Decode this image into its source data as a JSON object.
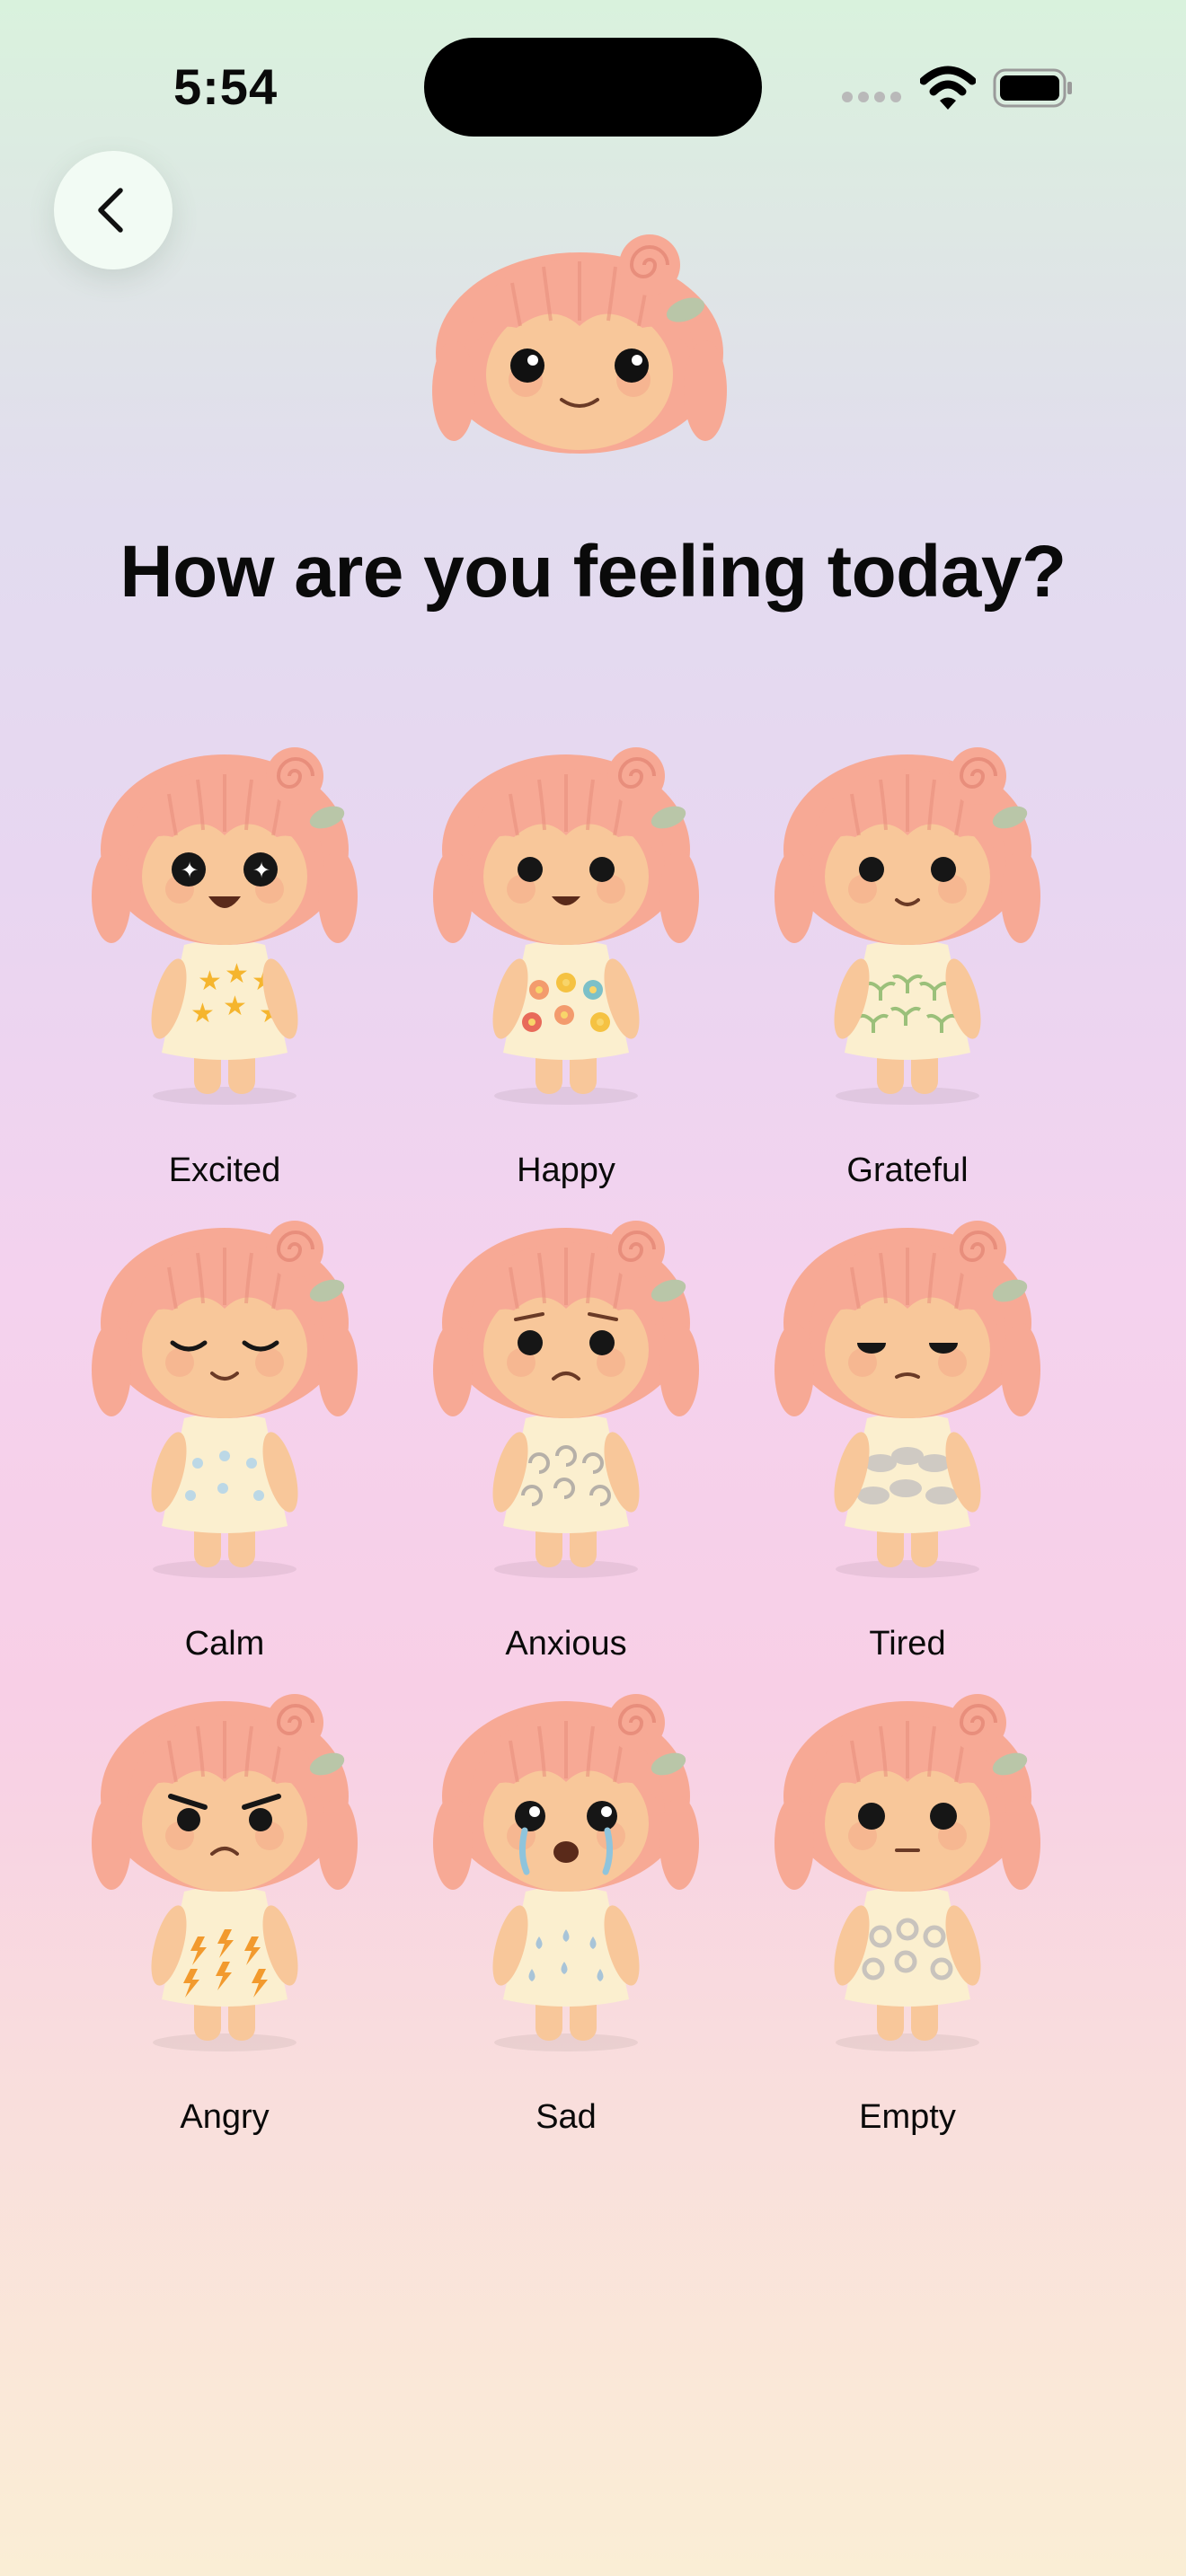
{
  "status_bar": {
    "time": "5:54"
  },
  "colors": {
    "hair": "#f7a995",
    "hair_shade": "#e88e7c",
    "skin": "#f8c79a",
    "skin_shade": "#eeb183",
    "dress": "#fbefcf",
    "clip": "#b9c6a8",
    "back_button_bg": "#f2fbf4"
  },
  "header": {
    "back_icon": "chevron-left-icon",
    "title": "How are you feeling today?"
  },
  "moods": [
    {
      "label": "Excited",
      "pattern": "stars",
      "face": "sparkle"
    },
    {
      "label": "Happy",
      "pattern": "flowers",
      "face": "happy"
    },
    {
      "label": "Grateful",
      "pattern": "sprouts",
      "face": "content"
    },
    {
      "label": "Calm",
      "pattern": "dots",
      "face": "closed"
    },
    {
      "label": "Anxious",
      "pattern": "swirls",
      "face": "worried"
    },
    {
      "label": "Tired",
      "pattern": "clouds",
      "face": "sleepy"
    },
    {
      "label": "Angry",
      "pattern": "bolts",
      "face": "angry"
    },
    {
      "label": "Sad",
      "pattern": "drops",
      "face": "crying"
    },
    {
      "label": "Empty",
      "pattern": "rings",
      "face": "blank"
    }
  ]
}
